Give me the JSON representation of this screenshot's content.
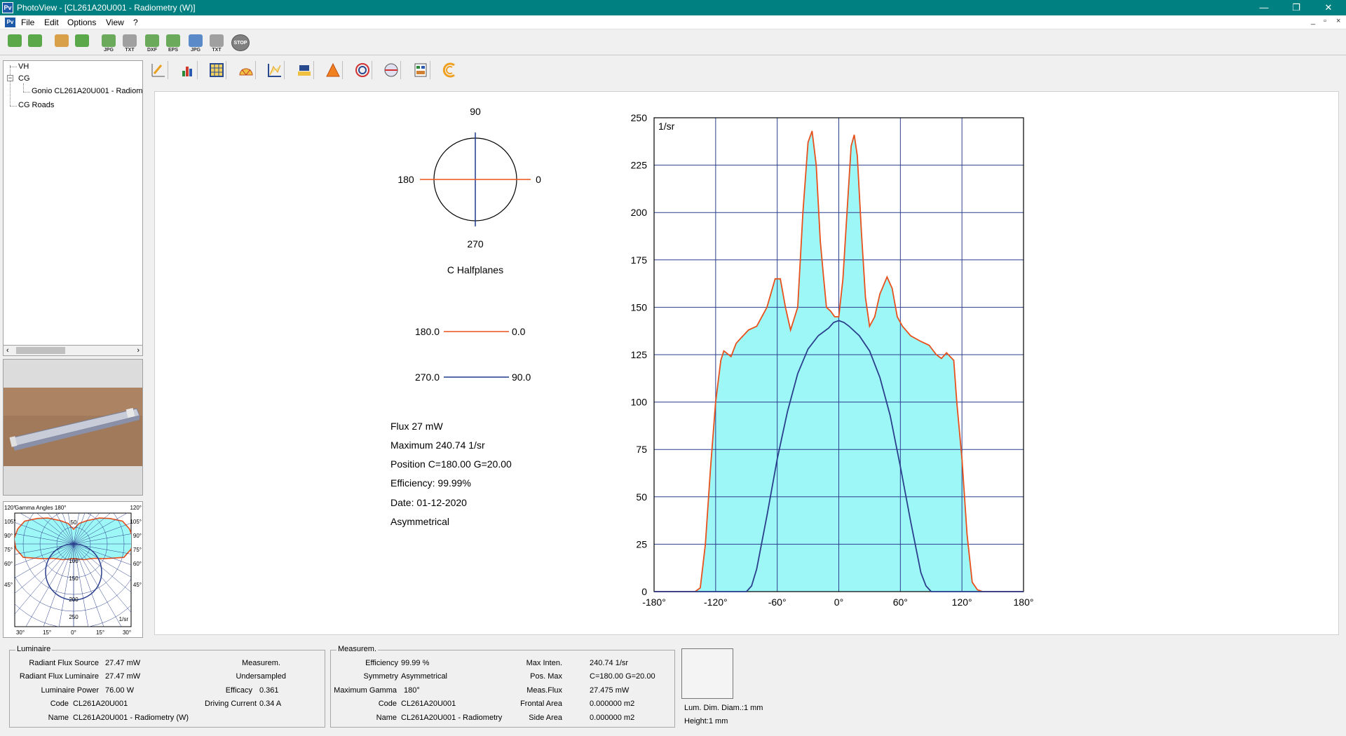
{
  "window": {
    "app_icon": "Pv",
    "title": "PhotoView - [CL261A20U001 - Radiometry (W)]",
    "minimize": "—",
    "restore": "❐",
    "close": "✕"
  },
  "menu": {
    "doc_icon": "Pv",
    "items": [
      "File",
      "Edit",
      "Options",
      "View",
      "?"
    ],
    "mdi_minimize": "_",
    "mdi_restore": "▫",
    "mdi_close": "×"
  },
  "toolbar": {
    "buttons": [
      {
        "icon": "people-green-icon",
        "caption": ""
      },
      {
        "icon": "people-green-icon",
        "caption": ""
      },
      {
        "icon": "people-orange-icon",
        "caption": ""
      },
      {
        "icon": "people-green-icon",
        "caption": ""
      },
      {
        "icon": "export-jpg-icon",
        "caption": "JPG"
      },
      {
        "icon": "export-txt-icon",
        "caption": "TXT"
      },
      {
        "icon": "export-dxf-icon",
        "caption": "DXF"
      },
      {
        "icon": "export-eps-icon",
        "caption": "EPS"
      },
      {
        "icon": "export-jpg-icon",
        "caption": "JPG"
      },
      {
        "icon": "export-txt-icon",
        "caption": "TXT"
      }
    ],
    "stop_label": "STOP"
  },
  "tree": {
    "items": [
      "VH",
      "CG",
      "Gonio CL261A20U001 - Radiometry (W)",
      "CG Roads"
    ],
    "expander": "−"
  },
  "scroll": {
    "left": "‹",
    "right": "›"
  },
  "thumb_polar": {
    "top_left": "120°",
    "title": "Gamma Angles  180°",
    "top_right": "120°",
    "left_ticks": [
      "105°",
      "90°",
      "75°",
      "60°",
      "45°"
    ],
    "right_ticks": [
      "105°",
      "90°",
      "75°",
      "60°",
      "45°"
    ],
    "bottom_ticks": [
      "30°",
      "15°",
      "0°",
      "15°",
      "30°"
    ],
    "radial_ticks": [
      "50",
      "100",
      "150",
      "200",
      "250"
    ],
    "unit": "1/sr"
  },
  "viewer_toolbar": {
    "icons": [
      "edit-chart-icon",
      "bar-chart-icon",
      "table-icon",
      "polar-icon",
      "line-chart-icon",
      "projection-icon",
      "cone-icon",
      "isolux-icon",
      "sphere-icon",
      "report-icon",
      "arc-icon"
    ]
  },
  "halfplanes": {
    "top": "90",
    "left": "180",
    "right": "0",
    "bottom": "270",
    "caption": "C Halfplanes",
    "legend": [
      {
        "from": "180.0",
        "to": "0.0",
        "color": "#e8501c"
      },
      {
        "from": "270.0",
        "to": "90.0",
        "color": "#1e3c8c"
      }
    ]
  },
  "info": [
    "Flux 27  mW",
    "Maximum 240.74  1/sr",
    "Position C=180.00 G=20.00",
    "Efficiency:  99.99%",
    "Date: 01-12-2020",
    "Asymmetrical"
  ],
  "chart_data": {
    "type": "area",
    "unit_label": "1/sr",
    "xlim": [
      -180,
      180
    ],
    "ylim": [
      0,
      250
    ],
    "x_ticks": [
      "-180°",
      "-120°",
      "-60°",
      "0°",
      "60°",
      "120°",
      "180°"
    ],
    "y_ticks": [
      "0",
      "25",
      "50",
      "75",
      "100",
      "125",
      "150",
      "175",
      "200",
      "225",
      "250"
    ],
    "grid": true,
    "series": [
      {
        "color": "#e8501c",
        "fill": "#9ef7f7",
        "x": [
          -180,
          -140,
          -135,
          -130,
          -125,
          -120,
          -115,
          -112,
          -105,
          -100,
          -95,
          -88,
          -80,
          -70,
          -62,
          -57,
          -52,
          -47,
          -40,
          -35,
          -30,
          -26,
          -22,
          -18,
          -15,
          -12,
          -8,
          -4,
          0,
          4,
          8,
          12,
          15,
          18,
          22,
          26,
          30,
          35,
          40,
          47,
          52,
          57,
          62,
          70,
          80,
          88,
          95,
          100,
          105,
          112,
          115,
          120,
          125,
          130,
          135,
          140,
          180
        ],
        "values": [
          0,
          0,
          2,
          25,
          65,
          100,
          122,
          127,
          124,
          131,
          134,
          138,
          140,
          150,
          165,
          165,
          150,
          138,
          150,
          200,
          237,
          243,
          225,
          185,
          167,
          150,
          148,
          145,
          145,
          165,
          200,
          235,
          241,
          230,
          190,
          155,
          140,
          145,
          157,
          166,
          160,
          145,
          140,
          135,
          132,
          130,
          125,
          123,
          126,
          122,
          100,
          70,
          30,
          5,
          1,
          0,
          0
        ]
      },
      {
        "color": "#2a3f8c",
        "x": [
          -180,
          -90,
          -85,
          -80,
          -70,
          -60,
          -50,
          -40,
          -30,
          -20,
          -10,
          -5,
          0,
          5,
          10,
          20,
          30,
          40,
          50,
          60,
          70,
          80,
          85,
          90,
          180
        ],
        "values": [
          0,
          0,
          3,
          12,
          40,
          70,
          95,
          115,
          128,
          135,
          139,
          142,
          143,
          142,
          140,
          135,
          127,
          113,
          93,
          66,
          37,
          10,
          3,
          0,
          0
        ]
      }
    ]
  },
  "bottom": {
    "luminaire": {
      "legend": "Luminaire",
      "rows": [
        {
          "label": "Radiant Flux Source",
          "value": "27.47 mW"
        },
        {
          "label": "Radiant Flux Luminaire",
          "value": "27.47 mW"
        },
        {
          "label": "Luminaire Power",
          "value": "76.00 W"
        },
        {
          "label": "Code",
          "value": "CL261A20U001"
        },
        {
          "label": "Name",
          "value": "CL261A20U001 - Radiometry (W)"
        }
      ],
      "measurem_label": "Measurem.",
      "measurem_value": "Undersampled",
      "efficacy_label": "Efficacy",
      "efficacy_value": "0.361",
      "driving_label": "Driving Current",
      "driving_value": "0.34 A"
    },
    "measurement": {
      "legend": "Measurem.",
      "rows": [
        {
          "label": "Efficiency",
          "value": "99.99 %"
        },
        {
          "label": "Symmetry",
          "value": "Asymmetrical"
        },
        {
          "label": "Maximum Gamma",
          "value": "180°"
        },
        {
          "label": "Code",
          "value": "CL261A20U001"
        },
        {
          "label": "Name",
          "value": "CL261A20U001 - Radiometry"
        }
      ],
      "right_rows": [
        {
          "label": "Max Inten.",
          "value": "240.74  1/sr"
        },
        {
          "label": "Pos. Max",
          "value": "C=180.00 G=20.00"
        },
        {
          "label": "Meas.Flux",
          "value": "27.475 mW"
        },
        {
          "label": "Frontal Area",
          "value": "0.000000 m2"
        },
        {
          "label": "Side Area",
          "value": "0.000000 m2"
        }
      ]
    },
    "dimensions": {
      "diam": "Lum. Dim. Diam.:1 mm",
      "height": "Height:1 mm"
    }
  }
}
